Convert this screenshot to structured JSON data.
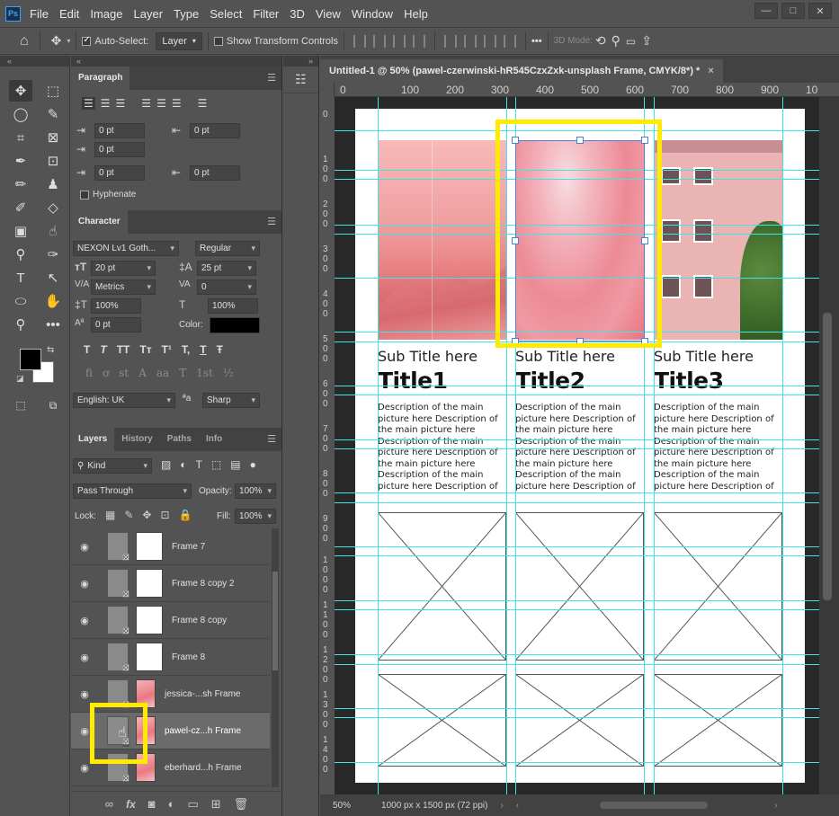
{
  "app": {
    "logo": "Ps"
  },
  "menu": [
    "File",
    "Edit",
    "Image",
    "Layer",
    "Type",
    "Select",
    "Filter",
    "3D",
    "View",
    "Window",
    "Help"
  ],
  "window_controls": {
    "minimize": "—",
    "maximize": "□",
    "close": "✕"
  },
  "options_bar": {
    "auto_select_label": "Auto-Select:",
    "auto_select_checked": true,
    "auto_select_target": "Layer",
    "show_transform_label": "Show Transform Controls",
    "show_transform_checked": false,
    "three_d_mode_label": "3D Mode:",
    "more_label": "•••"
  },
  "paragraph": {
    "tab": "Paragraph",
    "indent_left": "0 pt",
    "indent_right": "0 pt",
    "indent_first": "0 pt",
    "space_before": "0 pt",
    "space_after": "0 pt",
    "hyphenate_label": "Hyphenate"
  },
  "character": {
    "tab": "Character",
    "font_family": "NEXON Lv1 Goth...",
    "font_style": "Regular",
    "font_size": "20 pt",
    "leading": "25 pt",
    "kerning": "Metrics",
    "tracking": "0",
    "vertical_scale": "100%",
    "horizontal_scale": "100%",
    "baseline_shift": "0 pt",
    "color_label": "Color:",
    "color": "#000000",
    "language": "English: UK",
    "aa_label": "ªa",
    "antialias": "Sharp",
    "type_buttons": [
      "T",
      "T",
      "TT",
      "Tт",
      "T¹",
      "T,",
      "T",
      "Ŧ"
    ],
    "otf_buttons": [
      "fi",
      "ơ",
      "st",
      "A",
      "aa",
      "T",
      "1st",
      "½"
    ]
  },
  "layers": {
    "tabs": [
      "Layers",
      "History",
      "Paths",
      "Info"
    ],
    "active_tab": "Layers",
    "filter_kind": "Kind",
    "blend_mode": "Pass Through",
    "opacity_label": "Opacity:",
    "opacity": "100%",
    "lock_label": "Lock:",
    "fill_label": "Fill:",
    "fill": "100%",
    "items": [
      {
        "name": "Frame 7",
        "thumb": "white",
        "selected": false
      },
      {
        "name": "Frame 8 copy 2",
        "thumb": "white",
        "selected": false
      },
      {
        "name": "Frame 8 copy",
        "thumb": "white",
        "selected": false
      },
      {
        "name": "Frame 8",
        "thumb": "white",
        "selected": false
      },
      {
        "name": "jessica-...sh Frame",
        "thumb": "pink",
        "selected": false
      },
      {
        "name": "pawel-cz...h Frame",
        "thumb": "pink",
        "selected": true
      },
      {
        "name": "eberhard...h Frame",
        "thumb": "pink",
        "selected": false
      }
    ],
    "footer_icons": [
      "link-icon",
      "fx-icon",
      "mask-icon",
      "adjustment-icon",
      "folder-icon",
      "new-layer-icon",
      "trash-icon"
    ],
    "footer_glyphs": [
      "∞",
      "fx",
      "◙",
      "◐",
      "▭",
      "⊞",
      "🗑"
    ]
  },
  "document": {
    "tab_title": "Untitled-1 @ 50% (pawel-czerwinski-hR545CzxZxk-unsplash Frame, CMYK/8*) *",
    "close": "×",
    "ruler_h": [
      "0",
      "100",
      "200",
      "300",
      "400",
      "500",
      "600",
      "700",
      "800",
      "900",
      "10"
    ],
    "ruler_v": [
      "0",
      "1\n0\n0",
      "2\n0\n0",
      "3\n0\n0",
      "4\n0\n0",
      "5\n0\n0",
      "6\n0\n0",
      "7\n0\n0",
      "8\n0\n0",
      "9\n0\n0",
      "1\n0\n0\n0",
      "1\n1\n0\n0",
      "1\n2\n0\n0",
      "1\n3\n0\n0",
      "1\n4\n0\n0"
    ],
    "columns": [
      {
        "subtitle": "Sub Title here",
        "title": "Title1",
        "description": "Description of the main picture here Description of the main picture here Description of the main picture here Description of the main picture here Description of the main picture here Description of"
      },
      {
        "subtitle": "Sub Title here",
        "title": "Title2",
        "description": "Description of the main picture here Description of the main picture here Description of the main picture here Description of the main picture here Description of the main picture here Description of"
      },
      {
        "subtitle": "Sub Title here",
        "title": "Title3",
        "description": "Description of the main picture here Description of the main picture here Description of the main picture here Description of the main picture here Description of the main picture here Description of"
      }
    ],
    "zoom": "50%",
    "doc_info": "1000 px x 1500 px (72 ppi)"
  },
  "colors": {
    "highlight": "#ffeb00",
    "guide": "#3fe5e5",
    "selection": "#4d7fd6"
  }
}
